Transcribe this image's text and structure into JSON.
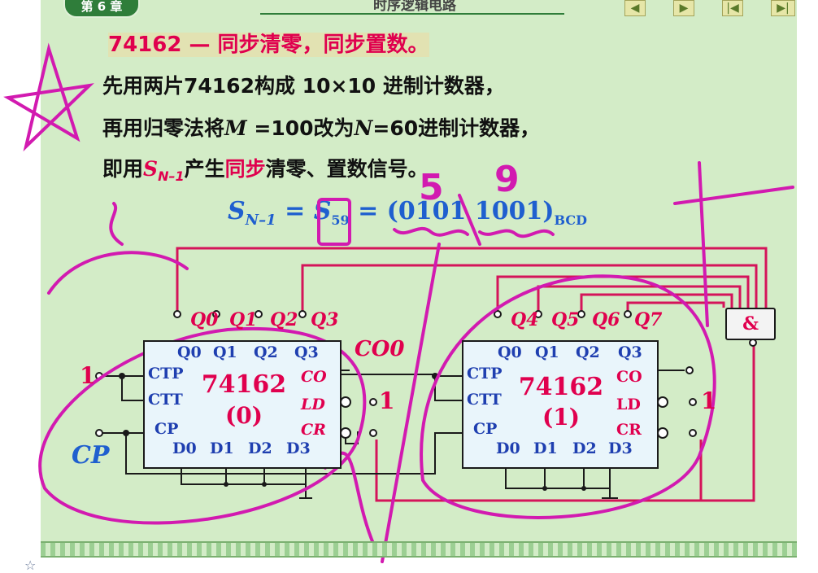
{
  "header": {
    "chapter": "第 6 章",
    "title": "时序逻辑电路"
  },
  "nav": [
    "◀",
    "▶",
    "|◀",
    "▶|"
  ],
  "heading": "74162 — 同步清零，同步置数。",
  "lines": [
    "先用两片74162构成 10×10 进制计数器，",
    {
      "a": "再用归零法将",
      "m": "M",
      "b": " =100改为",
      "n": "N",
      "c": "=60进制计数器，"
    },
    {
      "a": "即用",
      "s": "S",
      "sub": "N–1",
      "b": "产生",
      "red": "同步",
      "c": "清零、置数信号。"
    }
  ],
  "formula": {
    "lhs": "S",
    "lhs_sub": "N–1",
    "rhs": "S",
    "rhs_sub": "59",
    "bcd_hi": "0101",
    "bcd_lo": "1001",
    "bcd_label": "BCD"
  },
  "annotations": {
    "digit5": "5",
    "digit9": "9"
  },
  "chip0": {
    "name": "74162",
    "num": "(0)",
    "q_out": [
      "Q0",
      "Q1",
      "Q2",
      "Q3"
    ],
    "pins_top": [
      "Q0",
      "Q1",
      "Q2",
      "Q3"
    ],
    "ctp": "CTP",
    "ctt": "CTT",
    "cp": "CP",
    "co": "CO",
    "ld": "LD",
    "cr": "CR",
    "pins_bottom": [
      "D0",
      "D1",
      "D2",
      "D3"
    ],
    "co_label": "CO0"
  },
  "chip1": {
    "name": "74162",
    "num": "(1)",
    "q_out": [
      "Q4",
      "Q5",
      "Q6",
      "Q7"
    ],
    "pins_top": [
      "Q0",
      "Q1",
      "Q2",
      "Q3"
    ],
    "ctp": "CTP",
    "ctt": "CTT",
    "cp": "CP",
    "co": "CO",
    "ld": "LD",
    "cr": "CR",
    "pins_bottom": [
      "D0",
      "D1",
      "D2",
      "D3"
    ]
  },
  "gate": "&",
  "inputs": {
    "one": "1",
    "ld1_one": "1",
    "ld2_one": "1",
    "cp": "CP"
  },
  "colors": {
    "background": "#d3ecc7",
    "accent": "#e0004e",
    "blue": "#1f5fcf",
    "ink": "#d21ab0"
  }
}
